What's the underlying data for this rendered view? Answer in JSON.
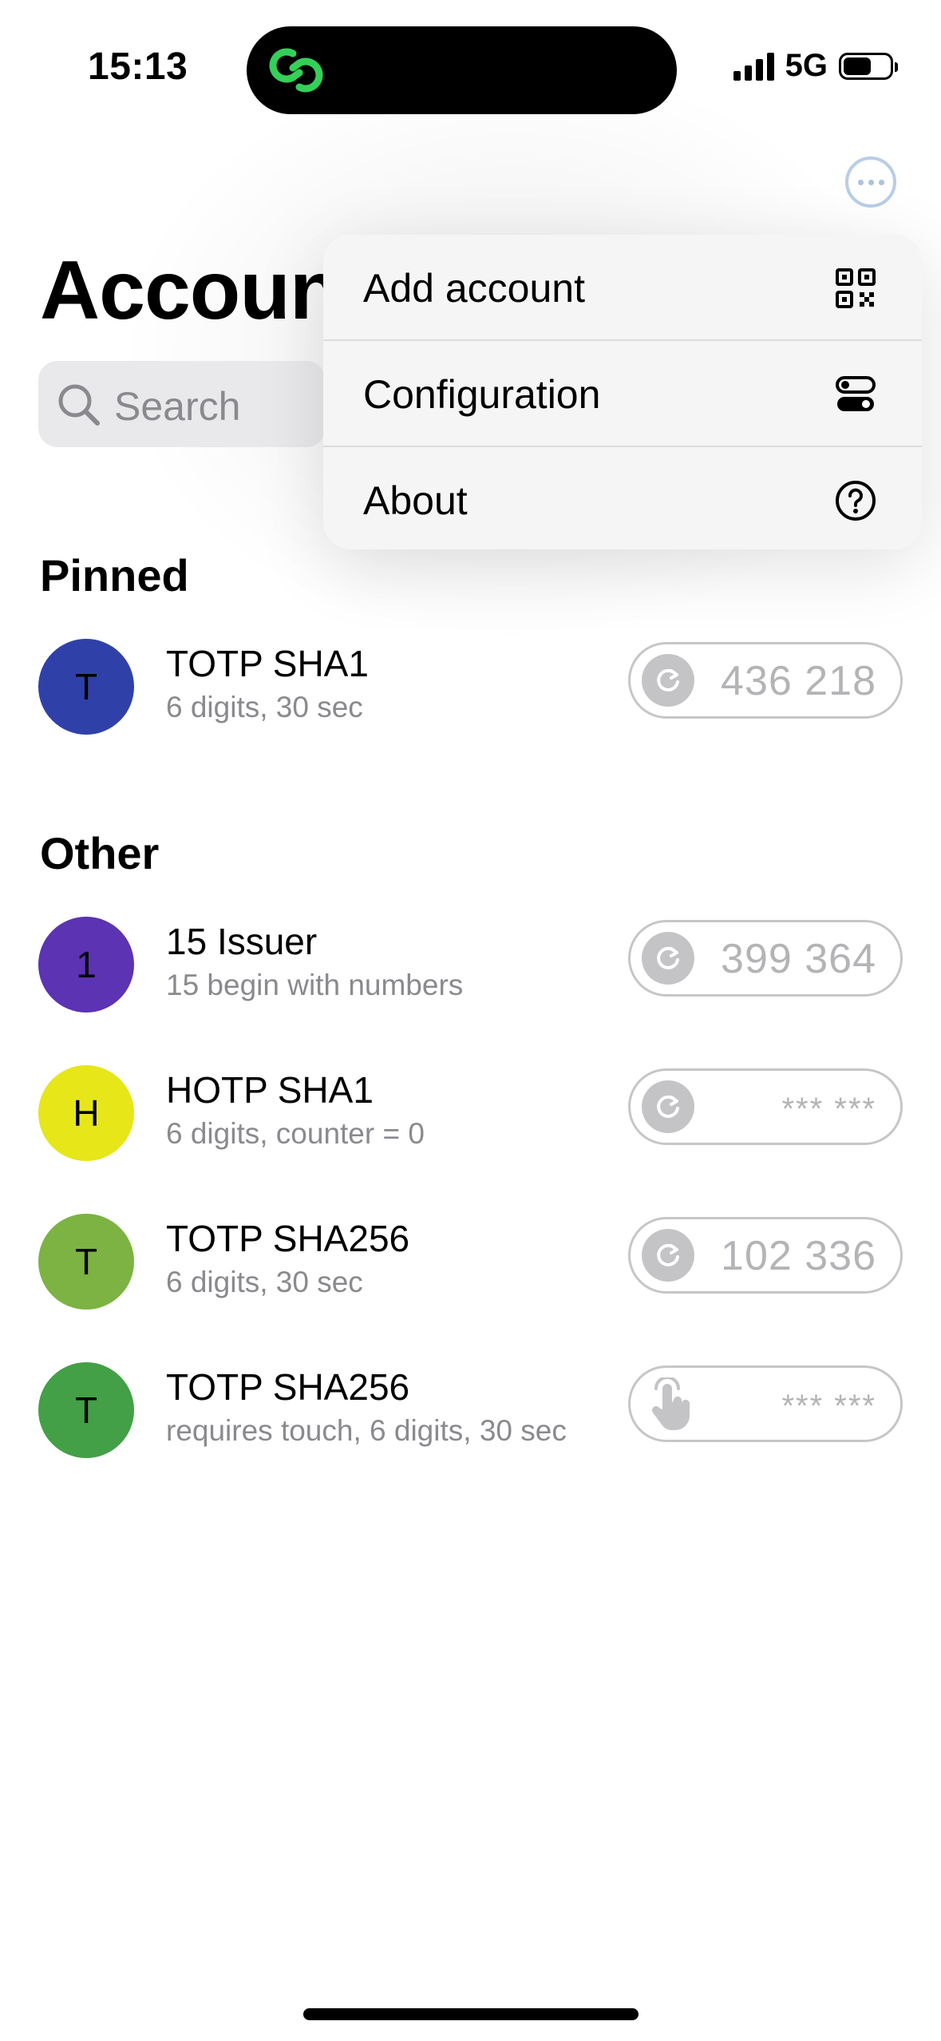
{
  "status_bar": {
    "time": "15:13",
    "network": "5G"
  },
  "header": {
    "title": "Accoun"
  },
  "search": {
    "placeholder": "Search"
  },
  "menu": {
    "items": [
      {
        "label": "Add account",
        "icon": "qr-code-icon"
      },
      {
        "label": "Configuration",
        "icon": "toggles-icon"
      },
      {
        "label": "About",
        "icon": "question-circle-icon"
      }
    ]
  },
  "sections": {
    "pinned": {
      "title": "Pinned",
      "accounts": [
        {
          "initial": "T",
          "name": "TOTP SHA1",
          "detail": "6 digits, 30 sec",
          "code": "436 218",
          "color": "#2f41a8",
          "action_icon": "refresh-icon"
        }
      ]
    },
    "other": {
      "title": "Other",
      "accounts": [
        {
          "initial": "1",
          "name": "15 Issuer",
          "detail": "15 begin with numbers",
          "code": "399 364",
          "color": "#5b33b3",
          "action_icon": "refresh-icon"
        },
        {
          "initial": "H",
          "name": "HOTP SHA1",
          "detail": "6 digits, counter = 0",
          "code": "*** ***",
          "color": "#e6e619",
          "action_icon": "refresh-icon"
        },
        {
          "initial": "T",
          "name": "TOTP SHA256",
          "detail": "6 digits, 30 sec",
          "code": "102 336",
          "color": "#7cb342",
          "action_icon": "refresh-icon"
        },
        {
          "initial": "T",
          "name": "TOTP SHA256",
          "detail": "requires touch, 6 digits, 30 sec",
          "code": "*** ***",
          "color": "#43a047",
          "action_icon": "touch-icon"
        }
      ]
    }
  },
  "colors": {
    "accent": "#a9c2e2",
    "island_icon": "#34d058"
  }
}
